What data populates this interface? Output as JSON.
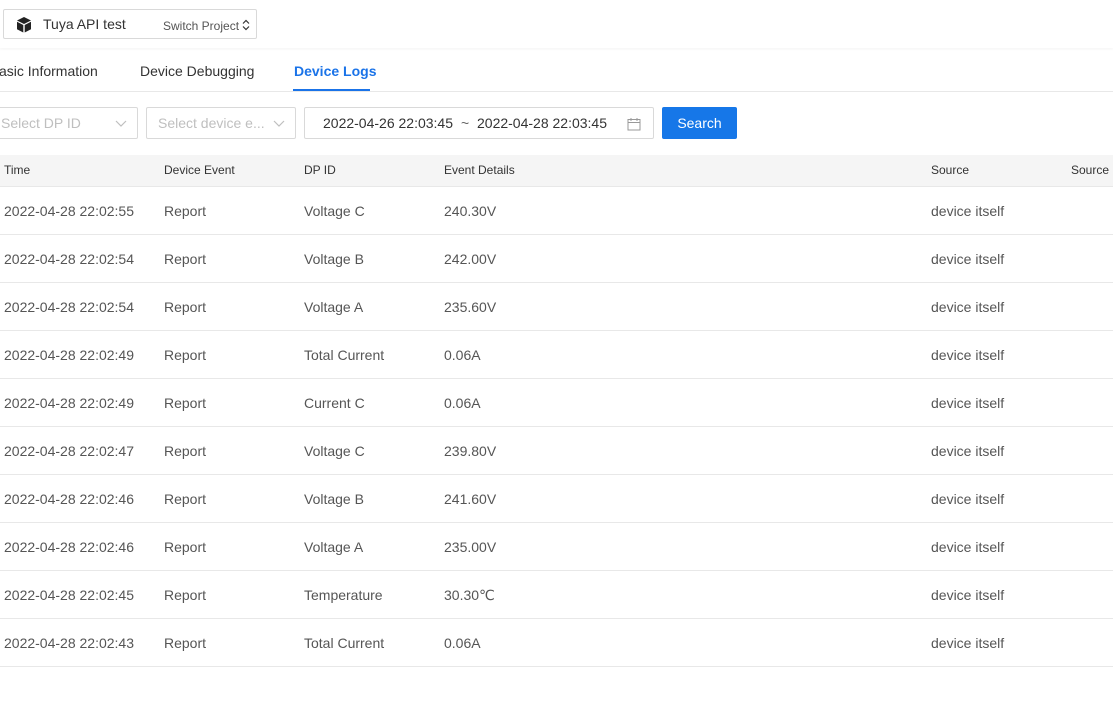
{
  "header": {
    "project_name": "Tuya API test",
    "switch_label": "Switch Project"
  },
  "tabs": [
    {
      "label": "asic Information",
      "active": false
    },
    {
      "label": "Device Debugging",
      "active": false
    },
    {
      "label": "Device Logs",
      "active": true
    }
  ],
  "filters": {
    "dp_id_placeholder": "Select DP ID",
    "device_event_placeholder": "Select device e...",
    "start_date": "2022-04-26 22:03:45",
    "separator": "~",
    "end_date": "2022-04-28 22:03:45",
    "search_label": "Search"
  },
  "table": {
    "columns": [
      "Time",
      "Device Event",
      "DP ID",
      "Event Details",
      "Source",
      "Source I"
    ],
    "rows": [
      [
        "2022-04-28 22:02:55",
        "Report",
        "Voltage C",
        "240.30V",
        "device itself"
      ],
      [
        "2022-04-28 22:02:54",
        "Report",
        "Voltage B",
        "242.00V",
        "device itself"
      ],
      [
        "2022-04-28 22:02:54",
        "Report",
        "Voltage A",
        "235.60V",
        "device itself"
      ],
      [
        "2022-04-28 22:02:49",
        "Report",
        "Total Current",
        "0.06A",
        "device itself"
      ],
      [
        "2022-04-28 22:02:49",
        "Report",
        "Current C",
        "0.06A",
        "device itself"
      ],
      [
        "2022-04-28 22:02:47",
        "Report",
        "Voltage C",
        "239.80V",
        "device itself"
      ],
      [
        "2022-04-28 22:02:46",
        "Report",
        "Voltage B",
        "241.60V",
        "device itself"
      ],
      [
        "2022-04-28 22:02:46",
        "Report",
        "Voltage A",
        "235.00V",
        "device itself"
      ],
      [
        "2022-04-28 22:02:45",
        "Report",
        "Temperature",
        "30.30℃",
        "device itself"
      ],
      [
        "2022-04-28 22:02:43",
        "Report",
        "Total Current",
        "0.06A",
        "device itself"
      ]
    ]
  },
  "colors": {
    "accent": "#1a73e8",
    "button": "#1677e8",
    "header_bg": "#f5f5f5",
    "border": "#e8e8e8"
  }
}
